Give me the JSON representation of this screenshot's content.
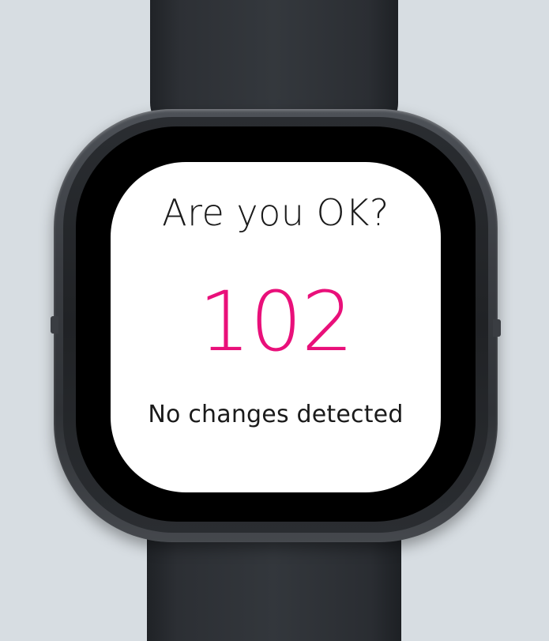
{
  "screen": {
    "title": "Are you OK?",
    "value": "102",
    "status": "No changes detected"
  },
  "colors": {
    "background": "#d7dde2",
    "accent_value": "#e9107a",
    "screen": "#ffffff",
    "text": "#1a1a1a"
  }
}
